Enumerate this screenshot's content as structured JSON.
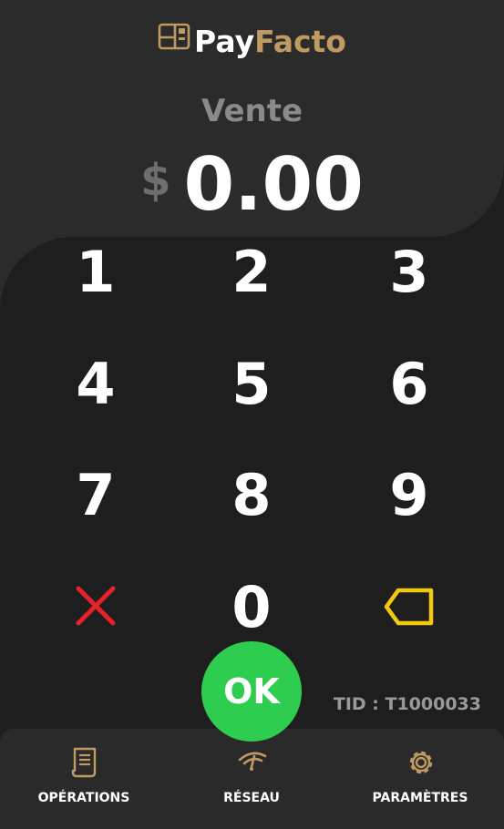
{
  "brand": {
    "pay": "Pay",
    "facto": "Facto",
    "icon": "card-logo-icon",
    "accent": "#c19a62"
  },
  "transaction": {
    "mode": "Vente",
    "currency": "$",
    "amount": "0.00"
  },
  "keypad": {
    "k1": "1",
    "k2": "2",
    "k3": "3",
    "k4": "4",
    "k5": "5",
    "k6": "6",
    "k7": "7",
    "k8": "8",
    "k9": "9",
    "k0": "0",
    "clear_icon": "close-x-icon",
    "clear_color": "#e8202a",
    "backspace_icon": "backspace-icon",
    "backspace_color": "#f2c811",
    "ok": "OK",
    "ok_color": "#2ecc4f"
  },
  "terminal": {
    "tid": "TID : T1000033"
  },
  "nav": {
    "operations": {
      "label": "OPÉRATIONS",
      "icon": "receipt-icon"
    },
    "network": {
      "label": "RÉSEAU",
      "icon": "signal-icon"
    },
    "settings": {
      "label": "PARAMÈTRES",
      "icon": "gear-icon"
    }
  }
}
